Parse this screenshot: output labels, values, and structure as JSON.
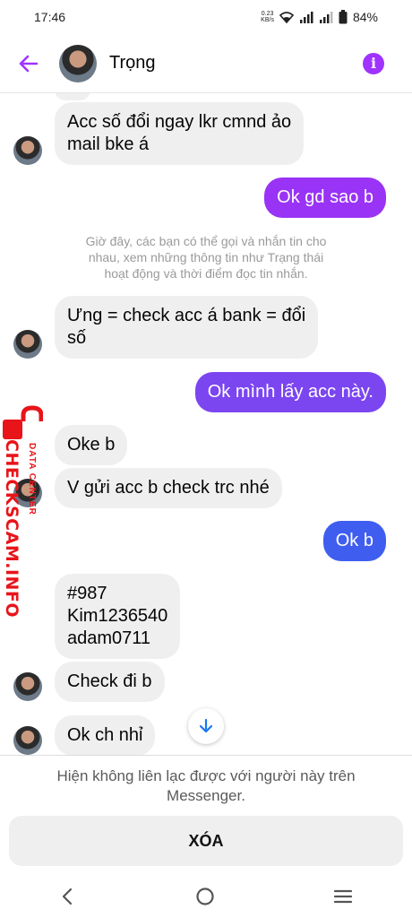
{
  "status_bar": {
    "time": "17:46",
    "net_speed_value": "0.23",
    "net_speed_unit": "KB/s",
    "battery": "84%"
  },
  "header": {
    "contact_name": "Trọng",
    "icons": [
      "back-arrow-icon",
      "info-icon"
    ]
  },
  "messages": [
    {
      "dir": "in",
      "lines": [
        "Acc số đổi ngay lkr cmnd ảo",
        "mail bke á"
      ]
    },
    {
      "dir": "out",
      "lines": [
        "Ok gd sao b"
      ]
    },
    {
      "dir": "in",
      "lines": [
        "Ưng = check acc á bank = đổi",
        "số"
      ]
    },
    {
      "dir": "out",
      "lines": [
        "Ok mình lấy acc này."
      ]
    },
    {
      "dir": "in",
      "lines": [
        "Oke b"
      ]
    },
    {
      "dir": "in",
      "lines": [
        "V gửi acc b check trc nhé"
      ]
    },
    {
      "dir": "out",
      "lines": [
        "Ok b"
      ]
    },
    {
      "dir": "in",
      "lines": [
        "#987",
        "Kim1236540",
        "adam0711"
      ]
    },
    {
      "dir": "in",
      "lines": [
        "Check đi b"
      ]
    },
    {
      "dir": "in",
      "lines": [
        "Ok ch nhỉ"
      ]
    }
  ],
  "system_note": [
    "Giờ đây, các bạn có thể gọi và nhắn tin cho",
    "nhau, xem những thông tin như Trạng thái",
    "hoạt động và thời điểm đọc tin nhắn."
  ],
  "watermark": {
    "main": "CHECKSCAM.INFO",
    "sub": "DATA CENTER"
  },
  "footer": {
    "blocked_message": [
      "Hiện không liên lạc được với người này trên",
      "Messenger."
    ],
    "delete_label": "XÓA"
  },
  "colors": {
    "accent": "#a033ff",
    "out_bubble_1": "#9933f5",
    "out_bubble_2": "#7b45f0",
    "out_bubble_3": "#3f5ef0",
    "in_bubble": "#efefef"
  },
  "nav_icons": [
    "back-nav-icon",
    "home-nav-icon",
    "recents-nav-icon"
  ]
}
